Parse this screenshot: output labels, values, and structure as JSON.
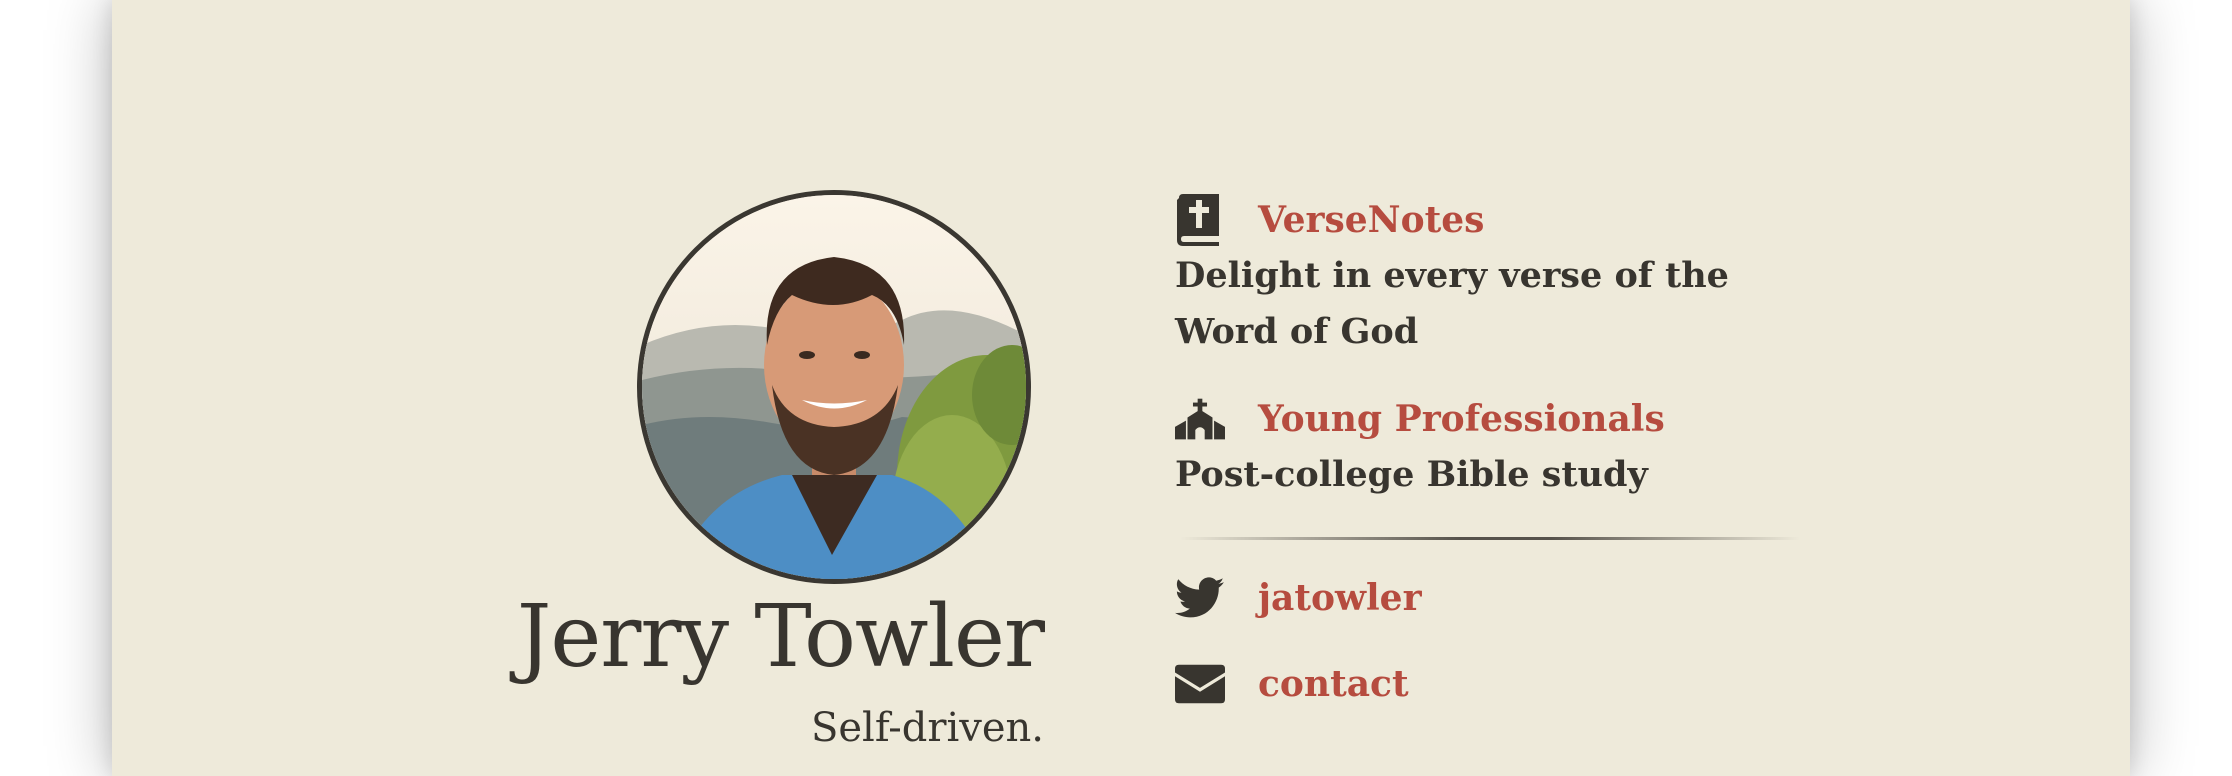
{
  "profile": {
    "name": "Jerry Towler",
    "tagline": "Self-driven."
  },
  "projects": [
    {
      "title": "VerseNotes",
      "description": "Delight in every verse of the Word of God",
      "icon": "bible-icon"
    },
    {
      "title": "Young Professionals",
      "description": "Post-college Bible study",
      "icon": "church-icon"
    }
  ],
  "contacts": [
    {
      "label": "jatowler",
      "icon": "twitter-icon"
    },
    {
      "label": "contact",
      "icon": "envelope-icon"
    }
  ],
  "colors": {
    "background": "#eeeada",
    "text": "#38352f",
    "accent": "#b64c3f"
  }
}
